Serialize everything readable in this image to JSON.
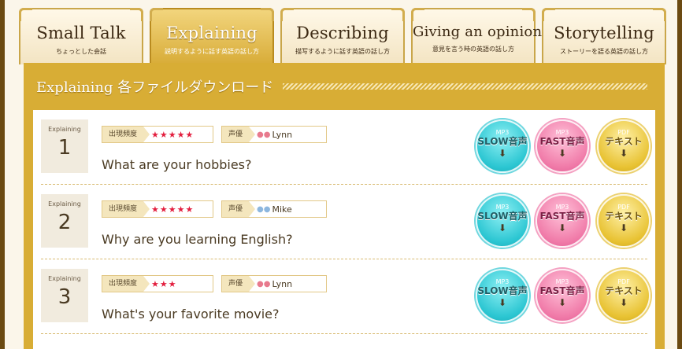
{
  "tabs": [
    {
      "title": "Small Talk",
      "subtitle": "ちょっとした会話"
    },
    {
      "title": "Explaining",
      "subtitle": "説明するように話す英語の話し方"
    },
    {
      "title": "Describing",
      "subtitle": "描写するように話す英語の話し方"
    },
    {
      "title": "Giving an opinion",
      "subtitle": "意見を言う時の英語の話し方"
    },
    {
      "title": "Storytelling",
      "subtitle": "ストーリーを語る英語の話し方"
    }
  ],
  "section": {
    "title": "Explaining 各ファイルダウンロード"
  },
  "tag_labels": {
    "frequency": "出現頻度",
    "voice": "声優"
  },
  "buttons": {
    "slow": {
      "top": "MP3",
      "main": "SLOW音声"
    },
    "fast": {
      "top": "MP3",
      "main": "FAST音声"
    },
    "pdf": {
      "top": "PDF",
      "main": "テキスト"
    }
  },
  "download_icon": "⬇",
  "items": [
    {
      "label": "Explaining",
      "number": "1",
      "stars": "★★★★★",
      "voice": "Lynn",
      "question": "What are your hobbies?"
    },
    {
      "label": "Explaining",
      "number": "2",
      "stars": "★★★★★",
      "voice": "Mike",
      "question": "Why are you learning English?"
    },
    {
      "label": "Explaining",
      "number": "3",
      "stars": "★★★",
      "voice": "Lynn",
      "question": "What's your favorite movie?"
    }
  ],
  "colors": {
    "gold": "#d8ad35",
    "slow": "#2bc6d2",
    "fast": "#f07aa8",
    "pdf": "#e8c232",
    "stars": "#e31e3e"
  }
}
